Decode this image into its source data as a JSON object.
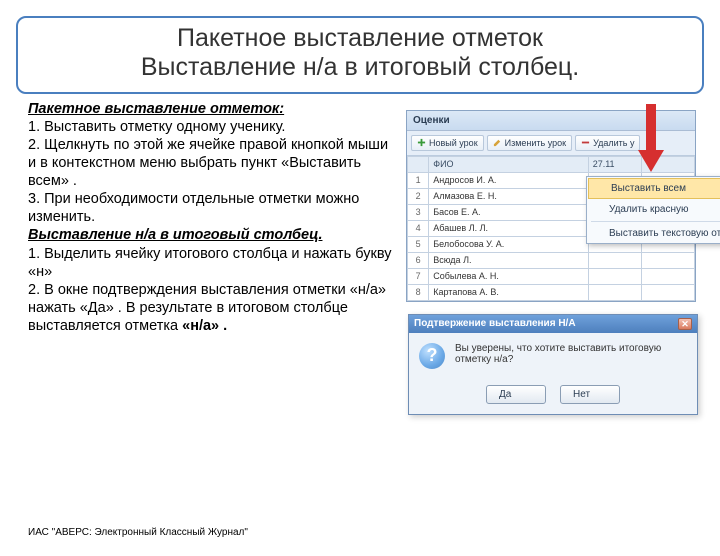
{
  "title_line1": "Пакетное выставление отметок",
  "title_line2": "Выставление н/а в итоговый столбец.",
  "instr": {
    "h1": "Пакетное выставление отметок:",
    "p1": "1. Выставить отметку одному ученику.",
    "p2": "2. Щелкнуть по этой же ячейке правой кнопкой мыши и в контекстном меню выбрать пункт «Выставить всем» .",
    "p3": "3. При необходимости отдельные отметки можно изменить.",
    "h2": "Выставление н/а в итоговый столбец.",
    "p4": "1. Выделить  ячейку итогового столбца и нажать букву «н»",
    "p5a": "2. В окне подтверждения выставления отметки «н/а» нажать «Да» .  В результате в итоговом столбце выставляется отметка ",
    "p5b": "«н/а» ."
  },
  "app": {
    "title": "Оценки",
    "toolbar": {
      "new": "Новый урок",
      "edit": "Изменить урок",
      "del": "Удалить у"
    },
    "col_fio": "ФИО",
    "col_date": "27.11",
    "rows": [
      {
        "n": "1",
        "name": "Андросов И. А."
      },
      {
        "n": "2",
        "name": "Алмазова Е. Н."
      },
      {
        "n": "3",
        "name": "Басов Е. А."
      },
      {
        "n": "4",
        "name": "Абашев Л. Л."
      },
      {
        "n": "5",
        "name": "Белобосова У. А."
      },
      {
        "n": "6",
        "name": "Всюда Л."
      },
      {
        "n": "7",
        "name": "Собылева А. Н."
      },
      {
        "n": "8",
        "name": "Картапова А. В."
      }
    ]
  },
  "menu": {
    "m1": "Выставить всем",
    "m2": "Удалить красную",
    "m3": "Выставить текстовую отметку"
  },
  "dialog": {
    "title": "Подтвержение выставления Н/А",
    "text": "Вы уверены, что хотите выставить итоговую отметку н/а?",
    "yes": "Да",
    "no": "Нет"
  },
  "footer": "ИАС \"АВЕРС: Электронный Классный Журнал\""
}
